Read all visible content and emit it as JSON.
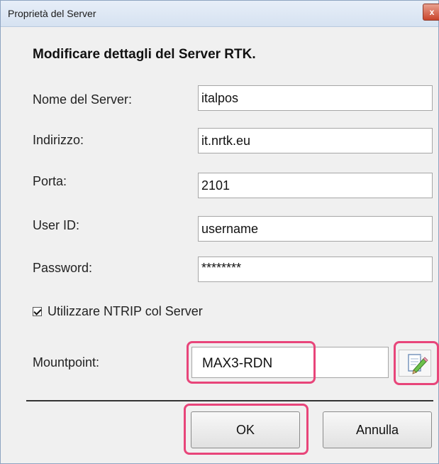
{
  "window": {
    "title": "Proprietà del Server",
    "close_glyph": "x"
  },
  "form": {
    "heading": "Modificare dettagli del Server RTK.",
    "fields": [
      {
        "label": "Nome del Server:",
        "value": "italpos"
      },
      {
        "label": "Indirizzo:",
        "value": "it.nrtk.eu"
      },
      {
        "label": "Porta:",
        "value": "2101"
      },
      {
        "label": "User ID:",
        "value": "username"
      },
      {
        "label": "Password:",
        "value": "********"
      }
    ],
    "ntrip_checkbox": {
      "label": "Utilizzare NTRIP col Server",
      "checked": true
    },
    "mountpoint": {
      "label": "Mountpoint:",
      "value": "MAX3-RDN",
      "edit_icon": "edit-pencil-icon"
    }
  },
  "buttons": {
    "ok_label": "OK",
    "cancel_label": "Annulla"
  },
  "colors": {
    "highlight": "#e8457a"
  }
}
